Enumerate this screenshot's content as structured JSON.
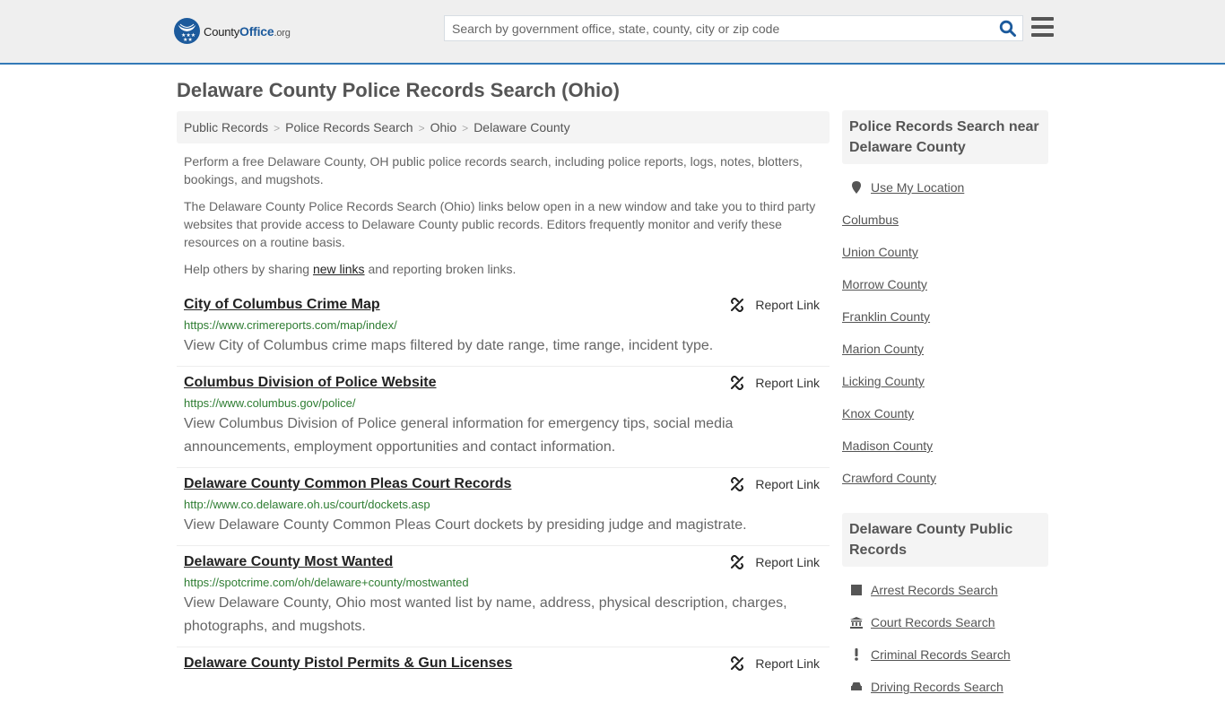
{
  "header": {
    "logo": {
      "county": "County",
      "office": "Office",
      "org": ".org"
    },
    "search": {
      "placeholder": "Search by government office, state, county, city or zip code",
      "value": ""
    },
    "colors": {
      "accent": "#337ab7",
      "brand": "#1c5a9c"
    }
  },
  "page": {
    "title": "Delaware County Police Records Search (Ohio)",
    "breadcrumb": [
      "Public Records",
      "Police Records Search",
      "Ohio",
      "Delaware County"
    ],
    "intro": {
      "p1": "Perform a free Delaware County, OH public police records search, including police reports, logs, notes, blotters, bookings, and mugshots.",
      "p2": "The Delaware County Police Records Search (Ohio) links below open in a new window and take you to third party websites that provide access to Delaware County public records. Editors frequently monitor and verify these resources on a routine basis.",
      "p3_before": "Help others by sharing ",
      "p3_link": "new links",
      "p3_after": " and reporting broken links."
    }
  },
  "results": [
    {
      "title": "City of Columbus Crime Map",
      "url": "https://www.crimereports.com/map/index/",
      "desc": "View City of Columbus crime maps filtered by date range, time range, incident type.",
      "report": "Report Link"
    },
    {
      "title": "Columbus Division of Police Website",
      "url": "https://www.columbus.gov/police/",
      "desc": "View Columbus Division of Police general information for emergency tips, social media announcements, employment opportunities and contact information.",
      "report": "Report Link"
    },
    {
      "title": "Delaware County Common Pleas Court Records",
      "url": "http://www.co.delaware.oh.us/court/dockets.asp",
      "desc": "View Delaware County Common Pleas Court dockets by presiding judge and magistrate.",
      "report": "Report Link"
    },
    {
      "title": "Delaware County Most Wanted",
      "url": "https://spotcrime.com/oh/delaware+county/mostwanted",
      "desc": "View Delaware County, Ohio most wanted list by name, address, physical description, charges, photographs, and mugshots.",
      "report": "Report Link"
    },
    {
      "title": "Delaware County Pistol Permits & Gun Licenses",
      "url": "",
      "desc": "",
      "report": "Report Link"
    }
  ],
  "sidebar": {
    "nearby": {
      "heading": "Police Records Search near Delaware County",
      "use_location": "Use My Location",
      "items": [
        "Columbus",
        "Union County",
        "Morrow County",
        "Franklin County",
        "Marion County",
        "Licking County",
        "Knox County",
        "Madison County",
        "Crawford County"
      ]
    },
    "public_records": {
      "heading": "Delaware County Public Records",
      "items": [
        {
          "label": "Arrest Records Search",
          "icon": "square-icon"
        },
        {
          "label": "Court Records Search",
          "icon": "courthouse-icon"
        },
        {
          "label": "Criminal Records Search",
          "icon": "exclamation-icon"
        },
        {
          "label": "Driving Records Search",
          "icon": "car-icon"
        }
      ]
    }
  }
}
